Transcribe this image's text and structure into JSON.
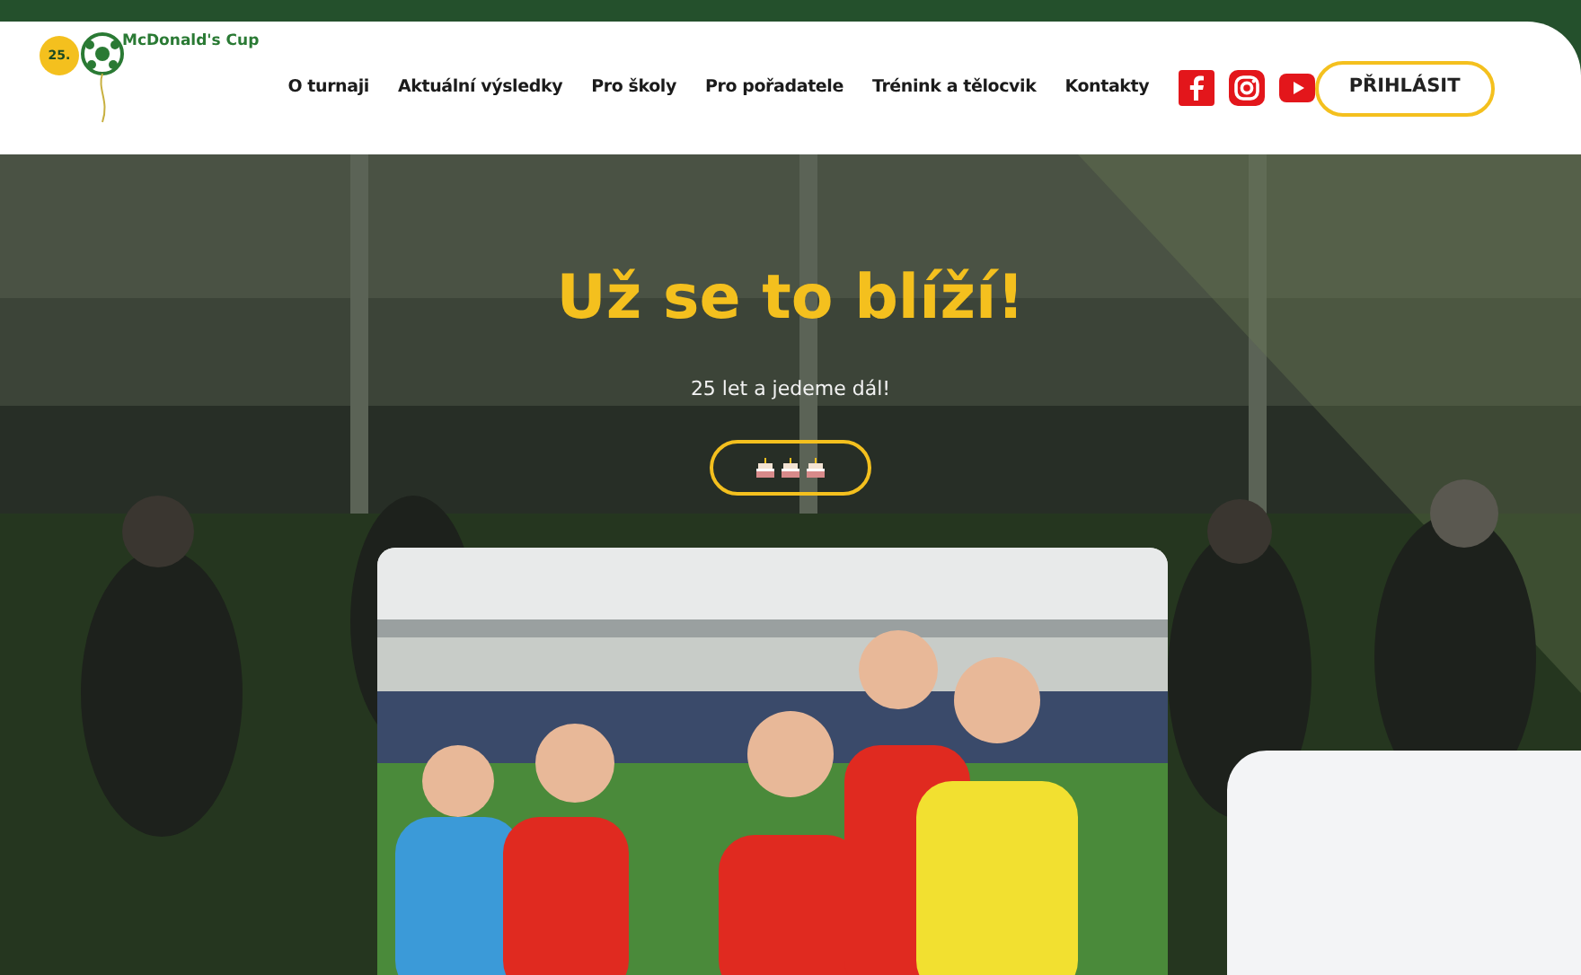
{
  "logo": {
    "badge": "25.",
    "name": "McDonald's Cup"
  },
  "nav": [
    {
      "label": "O turnaji"
    },
    {
      "label": "Aktuální výsledky"
    },
    {
      "label": "Pro školy"
    },
    {
      "label": "Pro pořadatele"
    },
    {
      "label": "Trénink a tělocvik"
    },
    {
      "label": "Kontakty"
    }
  ],
  "social": [
    {
      "kind": "facebook"
    },
    {
      "kind": "instagram"
    },
    {
      "kind": "youtube"
    }
  ],
  "login_button": "PŘIHLÁSIT",
  "hero": {
    "title": "Už se to blíží!",
    "subtitle": "25 let a jedeme dál!",
    "button": {
      "kind": "icons",
      "icons": [
        {
          "kind": "cake"
        },
        {
          "kind": "cake"
        },
        {
          "kind": "cake"
        }
      ]
    }
  }
}
